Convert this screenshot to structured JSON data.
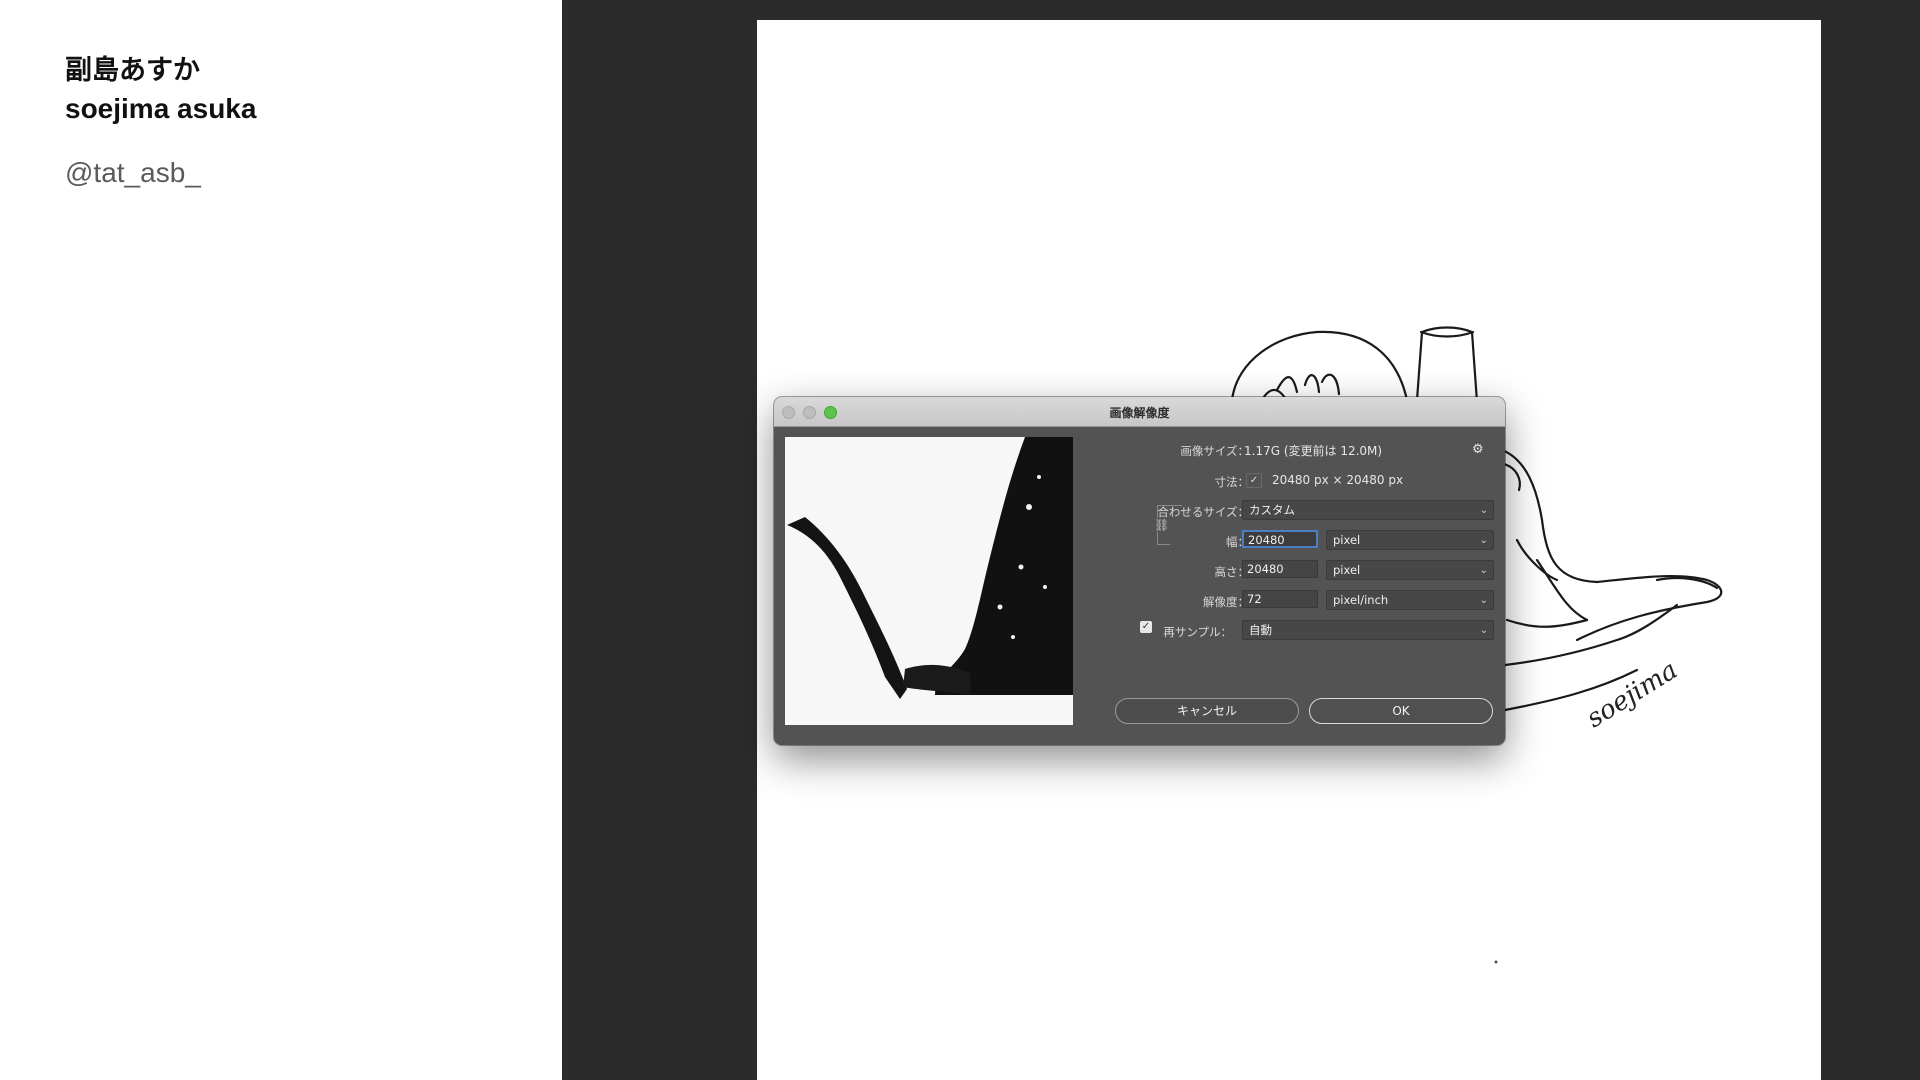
{
  "caption": {
    "name_jp": "副島あすか",
    "name_en": "soejima asuka",
    "handle": "@tat_asb_"
  },
  "dialog": {
    "title": "画像解像度",
    "image_size_label": "画像サイズ：",
    "image_size_value": "1.17G (変更前は 12.0M)",
    "dimensions_label": "寸法：",
    "dimensions_value": "20480 px × 20480 px",
    "fit_label": "合わせるサイズ：",
    "fit_value": "カスタム",
    "width_label": "幅：",
    "width_value": "20480",
    "width_unit": "pixel",
    "height_label": "高さ：",
    "height_value": "20480",
    "height_unit": "pixel",
    "resolution_label": "解像度：",
    "resolution_value": "72",
    "resolution_unit": "pixel/inch",
    "resample_label": "再サンプル：",
    "resample_checked": true,
    "resample_value": "自動",
    "cancel_label": "キャンセル",
    "ok_label": "OK"
  },
  "artwork": {
    "signature": "soejima"
  },
  "icons": {
    "gear": "gear-icon",
    "chain": "link-icon",
    "chevron": "chevron-down-icon"
  },
  "colors": {
    "workspace": "#2b2b2b",
    "dialog": "#535353",
    "zoom_button": "#5cc34f",
    "focus": "#4a7fc1"
  }
}
